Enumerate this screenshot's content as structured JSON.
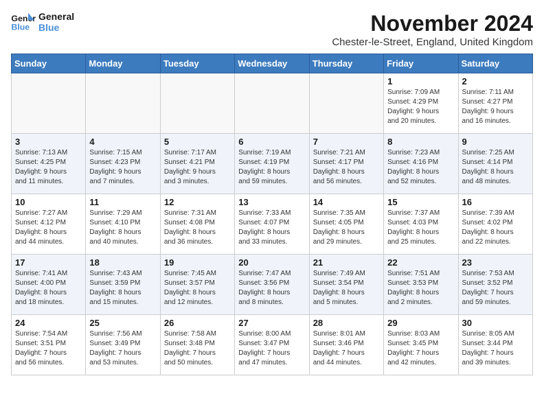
{
  "logo": {
    "line1": "General",
    "line2": "Blue"
  },
  "title": "November 2024",
  "subtitle": "Chester-le-Street, England, United Kingdom",
  "days_header": [
    "Sunday",
    "Monday",
    "Tuesday",
    "Wednesday",
    "Thursday",
    "Friday",
    "Saturday"
  ],
  "weeks": [
    {
      "alt": false,
      "days": [
        {
          "num": "",
          "info": ""
        },
        {
          "num": "",
          "info": ""
        },
        {
          "num": "",
          "info": ""
        },
        {
          "num": "",
          "info": ""
        },
        {
          "num": "",
          "info": ""
        },
        {
          "num": "1",
          "info": "Sunrise: 7:09 AM\nSunset: 4:29 PM\nDaylight: 9 hours\nand 20 minutes."
        },
        {
          "num": "2",
          "info": "Sunrise: 7:11 AM\nSunset: 4:27 PM\nDaylight: 9 hours\nand 16 minutes."
        }
      ]
    },
    {
      "alt": true,
      "days": [
        {
          "num": "3",
          "info": "Sunrise: 7:13 AM\nSunset: 4:25 PM\nDaylight: 9 hours\nand 11 minutes."
        },
        {
          "num": "4",
          "info": "Sunrise: 7:15 AM\nSunset: 4:23 PM\nDaylight: 9 hours\nand 7 minutes."
        },
        {
          "num": "5",
          "info": "Sunrise: 7:17 AM\nSunset: 4:21 PM\nDaylight: 9 hours\nand 3 minutes."
        },
        {
          "num": "6",
          "info": "Sunrise: 7:19 AM\nSunset: 4:19 PM\nDaylight: 8 hours\nand 59 minutes."
        },
        {
          "num": "7",
          "info": "Sunrise: 7:21 AM\nSunset: 4:17 PM\nDaylight: 8 hours\nand 56 minutes."
        },
        {
          "num": "8",
          "info": "Sunrise: 7:23 AM\nSunset: 4:16 PM\nDaylight: 8 hours\nand 52 minutes."
        },
        {
          "num": "9",
          "info": "Sunrise: 7:25 AM\nSunset: 4:14 PM\nDaylight: 8 hours\nand 48 minutes."
        }
      ]
    },
    {
      "alt": false,
      "days": [
        {
          "num": "10",
          "info": "Sunrise: 7:27 AM\nSunset: 4:12 PM\nDaylight: 8 hours\nand 44 minutes."
        },
        {
          "num": "11",
          "info": "Sunrise: 7:29 AM\nSunset: 4:10 PM\nDaylight: 8 hours\nand 40 minutes."
        },
        {
          "num": "12",
          "info": "Sunrise: 7:31 AM\nSunset: 4:08 PM\nDaylight: 8 hours\nand 36 minutes."
        },
        {
          "num": "13",
          "info": "Sunrise: 7:33 AM\nSunset: 4:07 PM\nDaylight: 8 hours\nand 33 minutes."
        },
        {
          "num": "14",
          "info": "Sunrise: 7:35 AM\nSunset: 4:05 PM\nDaylight: 8 hours\nand 29 minutes."
        },
        {
          "num": "15",
          "info": "Sunrise: 7:37 AM\nSunset: 4:03 PM\nDaylight: 8 hours\nand 25 minutes."
        },
        {
          "num": "16",
          "info": "Sunrise: 7:39 AM\nSunset: 4:02 PM\nDaylight: 8 hours\nand 22 minutes."
        }
      ]
    },
    {
      "alt": true,
      "days": [
        {
          "num": "17",
          "info": "Sunrise: 7:41 AM\nSunset: 4:00 PM\nDaylight: 8 hours\nand 18 minutes."
        },
        {
          "num": "18",
          "info": "Sunrise: 7:43 AM\nSunset: 3:59 PM\nDaylight: 8 hours\nand 15 minutes."
        },
        {
          "num": "19",
          "info": "Sunrise: 7:45 AM\nSunset: 3:57 PM\nDaylight: 8 hours\nand 12 minutes."
        },
        {
          "num": "20",
          "info": "Sunrise: 7:47 AM\nSunset: 3:56 PM\nDaylight: 8 hours\nand 8 minutes."
        },
        {
          "num": "21",
          "info": "Sunrise: 7:49 AM\nSunset: 3:54 PM\nDaylight: 8 hours\nand 5 minutes."
        },
        {
          "num": "22",
          "info": "Sunrise: 7:51 AM\nSunset: 3:53 PM\nDaylight: 8 hours\nand 2 minutes."
        },
        {
          "num": "23",
          "info": "Sunrise: 7:53 AM\nSunset: 3:52 PM\nDaylight: 7 hours\nand 59 minutes."
        }
      ]
    },
    {
      "alt": false,
      "days": [
        {
          "num": "24",
          "info": "Sunrise: 7:54 AM\nSunset: 3:51 PM\nDaylight: 7 hours\nand 56 minutes."
        },
        {
          "num": "25",
          "info": "Sunrise: 7:56 AM\nSunset: 3:49 PM\nDaylight: 7 hours\nand 53 minutes."
        },
        {
          "num": "26",
          "info": "Sunrise: 7:58 AM\nSunset: 3:48 PM\nDaylight: 7 hours\nand 50 minutes."
        },
        {
          "num": "27",
          "info": "Sunrise: 8:00 AM\nSunset: 3:47 PM\nDaylight: 7 hours\nand 47 minutes."
        },
        {
          "num": "28",
          "info": "Sunrise: 8:01 AM\nSunset: 3:46 PM\nDaylight: 7 hours\nand 44 minutes."
        },
        {
          "num": "29",
          "info": "Sunrise: 8:03 AM\nSunset: 3:45 PM\nDaylight: 7 hours\nand 42 minutes."
        },
        {
          "num": "30",
          "info": "Sunrise: 8:05 AM\nSunset: 3:44 PM\nDaylight: 7 hours\nand 39 minutes."
        }
      ]
    }
  ]
}
